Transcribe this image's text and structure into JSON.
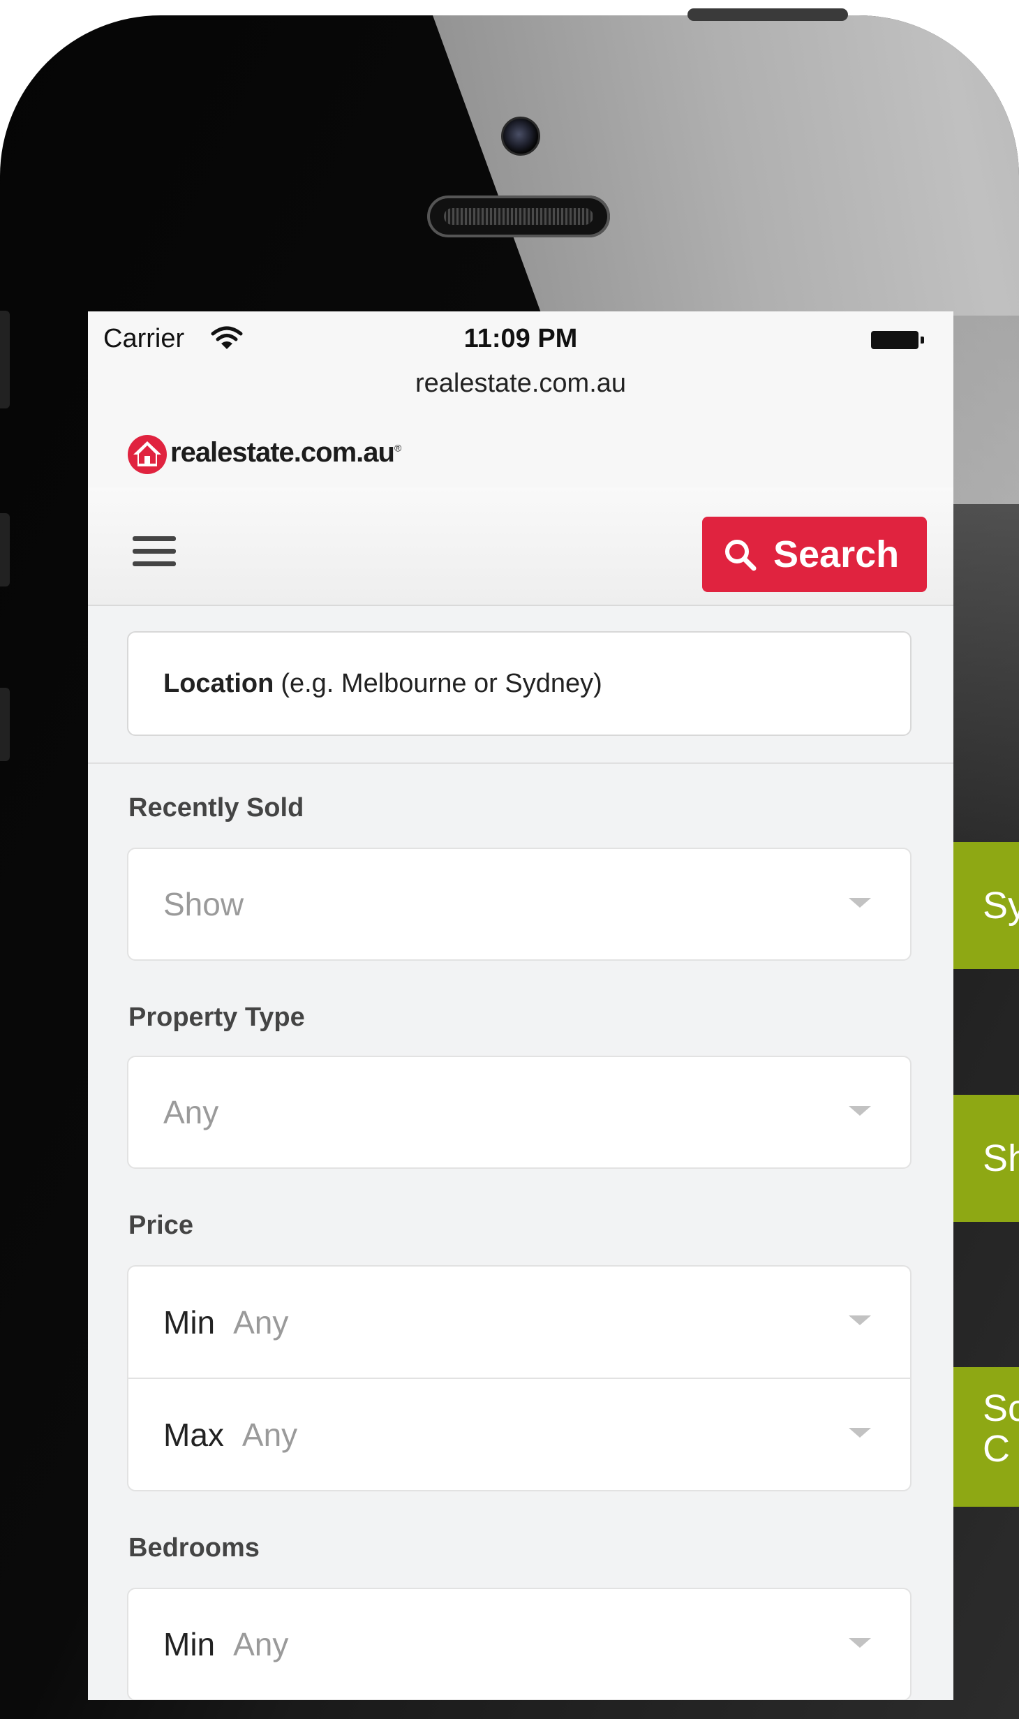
{
  "side_tabs": [
    "Sy",
    "Sh",
    "Sc",
    "C"
  ],
  "status_bar": {
    "carrier": "Carrier",
    "time": "11:09 PM",
    "url": "realestate.com.au"
  },
  "site": {
    "logo_text": "realestate.com.au",
    "logo_mark": "®",
    "brand_color": "#e0233f"
  },
  "toolbar": {
    "search_label": "Search"
  },
  "location": {
    "label": "Location",
    "hint": "(e.g. Melbourne or Sydney)"
  },
  "filters": {
    "recently_sold": {
      "label": "Recently Sold",
      "value": "Show"
    },
    "property_type": {
      "label": "Property Type",
      "value": "Any"
    },
    "price": {
      "label": "Price",
      "min_label": "Min",
      "min_value": "Any",
      "max_label": "Max",
      "max_value": "Any"
    },
    "bedrooms": {
      "label": "Bedrooms",
      "min_label": "Min",
      "min_value": "Any"
    }
  }
}
